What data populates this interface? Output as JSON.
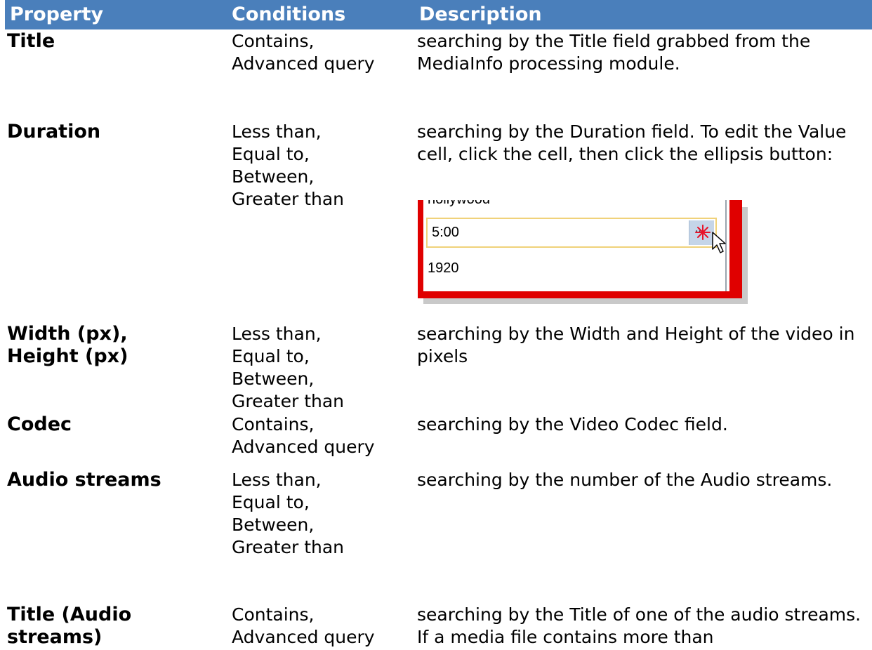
{
  "table": {
    "headers": [
      "Property",
      "Conditions",
      "Description"
    ],
    "rows": [
      {
        "property": "Title",
        "conditions": "Contains,\nAdvanced query",
        "description": "searching by the Title field grabbed from the MediaInfo processing module."
      },
      {
        "property": "Duration",
        "conditions": "Less than,\nEqual to,\nBetween,\nGreater than",
        "description": "searching by the Duration field. To edit the Value cell, click the cell, then click the ellipsis button:"
      },
      {
        "property": "Width (px),\nHeight (px)",
        "conditions": "Less than,\nEqual to,\nBetween,\nGreater than",
        "description": "searching by the Width and Height of the video in pixels"
      },
      {
        "property": "Codec",
        "conditions": "Contains,\nAdvanced query",
        "description": "searching by the Video Codec field."
      },
      {
        "property": "Audio streams",
        "conditions": "Less than,\nEqual to,\nBetween,\nGreater than",
        "description": "searching by the number of the Audio streams."
      },
      {
        "property": "Title (Audio\nstreams)",
        "conditions": "Contains,\nAdvanced query",
        "description": "searching by the Title of one of the audio streams. If a media file contains more than"
      }
    ]
  },
  "screenshot": {
    "row_above": "hollywood",
    "edit_value": "5:00",
    "row_below": "1920",
    "ellipsis_label": "...",
    "icons": [
      "ellipsis-button-icon",
      "mouse-cursor-icon",
      "click-spark-icon"
    ]
  },
  "colors": {
    "header_bg": "#4a7fbb",
    "header_text": "#ffffff",
    "highlight_frame": "#e00000",
    "edit_border": "#f0d27a"
  }
}
